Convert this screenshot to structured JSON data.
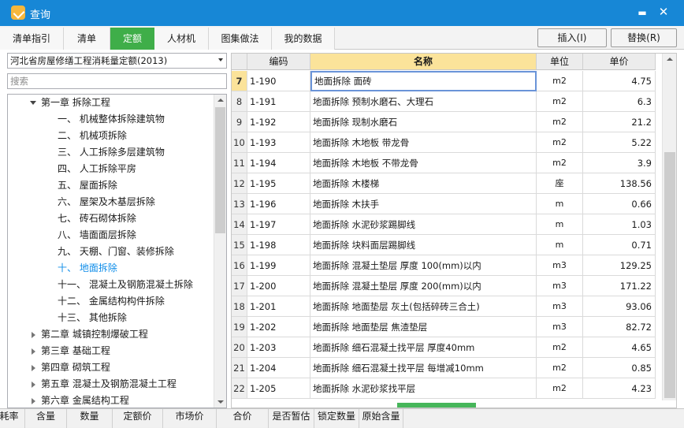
{
  "window": {
    "title": "查询"
  },
  "tabs": [
    {
      "label": "清单指引",
      "active": false
    },
    {
      "label": "清单",
      "active": false
    },
    {
      "label": "定额",
      "active": true
    },
    {
      "label": "人材机",
      "active": false
    },
    {
      "label": "图集做法",
      "active": false
    },
    {
      "label": "我的数据",
      "active": false
    }
  ],
  "buttons": {
    "insert": "插入(I)",
    "replace": "替换(R)"
  },
  "left": {
    "dropdown_value": "河北省房屋修缮工程消耗量定额(2013)",
    "search_placeholder": "搜索",
    "tree": [
      {
        "label": "第一章  拆除工程",
        "level": 0,
        "expander": "open"
      },
      {
        "label": "一、  机械整体拆除建筑物",
        "level": 1
      },
      {
        "label": "二、  机械项拆除",
        "level": 1
      },
      {
        "label": "三、  人工拆除多层建筑物",
        "level": 1
      },
      {
        "label": "四、  人工拆除平房",
        "level": 1
      },
      {
        "label": "五、  屋面拆除",
        "level": 1
      },
      {
        "label": "六、  屋架及木基层拆除",
        "level": 1
      },
      {
        "label": "七、  砖石砌体拆除",
        "level": 1
      },
      {
        "label": "八、  墙面面层拆除",
        "level": 1
      },
      {
        "label": "九、  天棚、门窗、装修拆除",
        "level": 1
      },
      {
        "label": "十、  地面拆除",
        "level": 1,
        "selected": true
      },
      {
        "label": "十一、  混凝土及钢筋混凝土拆除",
        "level": 1
      },
      {
        "label": "十二、  金属结构构件拆除",
        "level": 1
      },
      {
        "label": "十三、  其他拆除",
        "level": 1
      },
      {
        "label": "第二章  城镇控制爆破工程",
        "level": 0,
        "expander": "closed"
      },
      {
        "label": "第三章  基础工程",
        "level": 0,
        "expander": "closed"
      },
      {
        "label": "第四章  砌筑工程",
        "level": 0,
        "expander": "closed"
      },
      {
        "label": "第五章  混凝土及钢筋混凝土工程",
        "level": 0,
        "expander": "closed"
      },
      {
        "label": "第六章  金属结构工程",
        "level": 0,
        "expander": "closed"
      }
    ]
  },
  "grid": {
    "columns": {
      "code": "编码",
      "name": "名称",
      "unit": "单位",
      "price": "单价"
    },
    "rows": [
      {
        "n": "7",
        "code": "1-190",
        "name": "地面拆除  面砖",
        "unit": "m2",
        "price": "4.75",
        "current": true
      },
      {
        "n": "8",
        "code": "1-191",
        "name": "地面拆除  预制水磨石、大理石",
        "unit": "m2",
        "price": "6.3"
      },
      {
        "n": "9",
        "code": "1-192",
        "name": "地面拆除  现制水磨石",
        "unit": "m2",
        "price": "21.2"
      },
      {
        "n": "10",
        "code": "1-193",
        "name": "地面拆除  木地板  带龙骨",
        "unit": "m2",
        "price": "5.22"
      },
      {
        "n": "11",
        "code": "1-194",
        "name": "地面拆除  木地板  不带龙骨",
        "unit": "m2",
        "price": "3.9"
      },
      {
        "n": "12",
        "code": "1-195",
        "name": "地面拆除  木楼梯",
        "unit": "座",
        "price": "138.56"
      },
      {
        "n": "13",
        "code": "1-196",
        "name": "地面拆除  木扶手",
        "unit": "m",
        "price": "0.66"
      },
      {
        "n": "14",
        "code": "1-197",
        "name": "地面拆除  水泥砂浆踢脚线",
        "unit": "m",
        "price": "1.03"
      },
      {
        "n": "15",
        "code": "1-198",
        "name": "地面拆除  块料面层踢脚线",
        "unit": "m",
        "price": "0.71"
      },
      {
        "n": "16",
        "code": "1-199",
        "name": "地面拆除  混凝土垫层  厚度 100(mm)以内",
        "unit": "m3",
        "price": "129.25"
      },
      {
        "n": "17",
        "code": "1-200",
        "name": "地面拆除  混凝土垫层  厚度 200(mm)以内",
        "unit": "m3",
        "price": "171.22"
      },
      {
        "n": "18",
        "code": "1-201",
        "name": "地面拆除  地面垫层  灰土(包括碎砖三合土)",
        "unit": "m3",
        "price": "93.06"
      },
      {
        "n": "19",
        "code": "1-202",
        "name": "地面拆除  地面垫层  焦渣垫层",
        "unit": "m3",
        "price": "82.72"
      },
      {
        "n": "20",
        "code": "1-203",
        "name": "地面拆除  细石混凝土找平层  厚度40mm",
        "unit": "m2",
        "price": "4.65"
      },
      {
        "n": "21",
        "code": "1-204",
        "name": "地面拆除  细石混凝土找平层  每增减10mm",
        "unit": "m2",
        "price": "0.85"
      },
      {
        "n": "22",
        "code": "1-205",
        "name": "地面拆除  水泥砂浆找平层",
        "unit": "m2",
        "price": "4.23"
      }
    ]
  },
  "bottom_columns": [
    "耗率",
    "含量",
    "数量",
    "定额价",
    "市场价",
    "合价",
    "是否暂估",
    "锁定数量",
    "原始含量"
  ]
}
